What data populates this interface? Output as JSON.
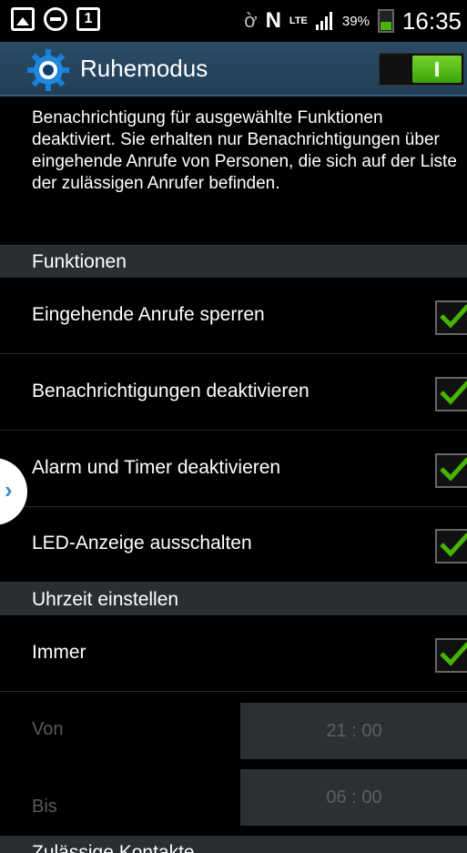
{
  "status_bar": {
    "calendar_day": "1",
    "network": "N",
    "lte": "LTE",
    "battery_percent": "39%",
    "time": "16:35",
    "icons": [
      "picture-icon",
      "minus-circle-icon",
      "calendar-icon",
      "eye-icon",
      "nfc-icon",
      "lte-icon",
      "signal-icon",
      "battery-icon"
    ]
  },
  "action_bar": {
    "title": "Ruhemodus",
    "icon": "settings-gear-icon",
    "toggle_on": true
  },
  "description": "Benachrichtigung für ausgewählte Funktionen deaktiviert. Sie erhalten nur Benachrichtigungen über eingehende Anrufe von Personen, die sich auf der Liste der zulässigen Anrufer befinden.",
  "sections": {
    "funktionen": "Funktionen",
    "uhrzeit": "Uhrzeit einstellen",
    "kontakte": "Zulässige Kontakte"
  },
  "functions": [
    {
      "label": "Eingehende Anrufe sperren",
      "checked": true
    },
    {
      "label": "Benachrichtigungen deaktivieren",
      "checked": true
    },
    {
      "label": "Alarm und Timer deaktivieren",
      "checked": true
    },
    {
      "label": "LED-Anzeige ausschalten",
      "checked": true
    }
  ],
  "time": {
    "always_label": "Immer",
    "always_checked": true,
    "from_label": "Von",
    "from_value": "21 : 00",
    "to_label": "Bis",
    "to_value": "06 : 00"
  },
  "colors": {
    "accent_green": "#46b400",
    "action_bar": "#2a4b66",
    "section_header": "#2a2d31"
  }
}
